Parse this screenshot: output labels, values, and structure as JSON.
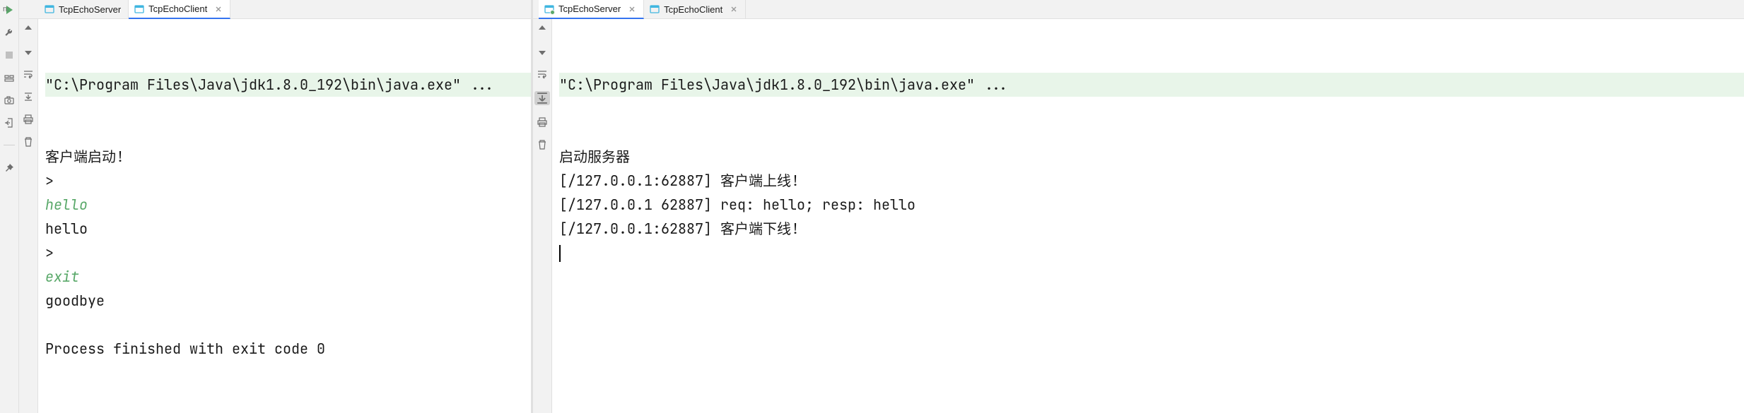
{
  "run_label": "n:",
  "panels": {
    "left": {
      "tabs": [
        {
          "label": "TcpEchoServer",
          "running": false,
          "active": false
        },
        {
          "label": "TcpEchoClient",
          "running": false,
          "active": true
        }
      ],
      "console": {
        "command": "\"C:\\Program Files\\Java\\jdk1.8.0_192\\bin\\java.exe\" ...",
        "lines": [
          {
            "text": "客户端启动!",
            "style": "plain"
          },
          {
            "text": ">",
            "style": "plain"
          },
          {
            "text": "hello",
            "style": "input"
          },
          {
            "text": "hello",
            "style": "plain"
          },
          {
            "text": ">",
            "style": "plain"
          },
          {
            "text": "exit",
            "style": "input"
          },
          {
            "text": "goodbye",
            "style": "plain"
          },
          {
            "text": "",
            "style": "plain"
          },
          {
            "text": "Process finished with exit code 0",
            "style": "plain"
          }
        ]
      }
    },
    "right": {
      "tabs": [
        {
          "label": "TcpEchoServer",
          "running": true,
          "active": true
        },
        {
          "label": "TcpEchoClient",
          "running": false,
          "active": false
        }
      ],
      "console": {
        "command": "\"C:\\Program Files\\Java\\jdk1.8.0_192\\bin\\java.exe\" ...",
        "lines": [
          {
            "text": "启动服务器",
            "style": "plain"
          },
          {
            "text": "[/127.0.0.1:62887] 客户端上线!",
            "style": "plain"
          },
          {
            "text": "[/127.0.0.1 62887] req: hello; resp: hello",
            "style": "plain"
          },
          {
            "text": "[/127.0.0.1:62887] 客户端下线!",
            "style": "plain"
          }
        ],
        "has_cursor": true
      }
    }
  },
  "icons": {
    "run": "run-icon",
    "wrench": "wrench-icon",
    "stop": "stop-icon",
    "layout": "layout-icon",
    "camera": "camera-icon",
    "exit": "exit-icon",
    "pin": "pin-icon",
    "up": "up-arrow-icon",
    "down": "down-arrow-icon",
    "wrap": "wrap-icon",
    "scroll_end": "scroll-end-icon",
    "print": "print-icon",
    "trash": "trash-icon"
  }
}
